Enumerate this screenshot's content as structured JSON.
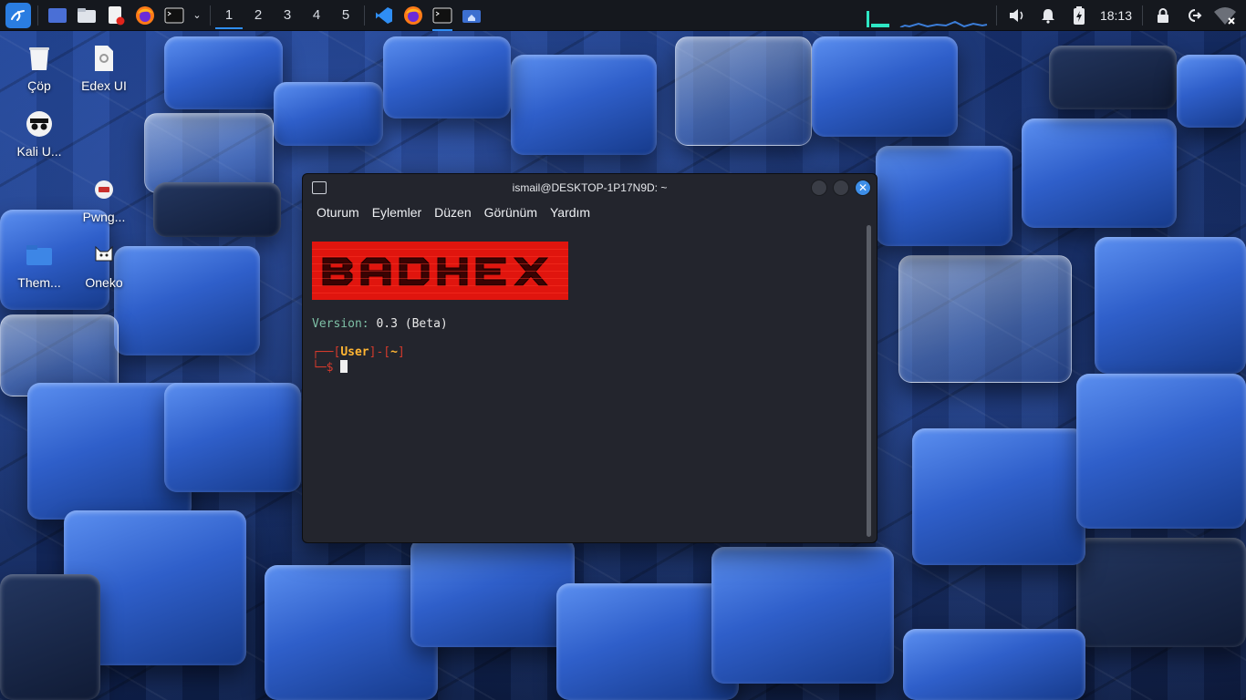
{
  "taskbar": {
    "workspaces": [
      "1",
      "2",
      "3",
      "4",
      "5"
    ],
    "active_workspace": "1",
    "clock": "18:13",
    "accent": "#2f8ef4"
  },
  "desktop": {
    "icons": [
      {
        "label": "Çöp",
        "icon": "trash-icon"
      },
      {
        "label": "Edex UI",
        "icon": "file-gear-icon"
      },
      {
        "label": "Kali U...",
        "icon": "kali-undercover-icon"
      },
      {
        "label": "Pwng...",
        "icon": "pwnagotchi-icon"
      },
      {
        "label": "Them...",
        "icon": "folder-icon"
      },
      {
        "label": "Oneko",
        "icon": "cat-icon"
      }
    ]
  },
  "terminal": {
    "title": "ismail@DESKTOP-1P17N9D: ~",
    "menu": [
      "Oturum",
      "Eylemler",
      "Düzen",
      "Görünüm",
      "Yardım"
    ],
    "banner_text": "BADHEX",
    "version_label": "Version:",
    "version_value": "0.3 (Beta)",
    "prompt_user": "User",
    "prompt_dir": "~",
    "prompt_line1_pre": "┌──[",
    "prompt_line1_mid": "]-[",
    "prompt_line1_end": "]",
    "prompt_line2": "└─$ ",
    "colors": {
      "banner": "#e0150e",
      "user": "#ffb533",
      "prompt": "#d33a2c",
      "version_label": "#7ec0a6"
    }
  }
}
